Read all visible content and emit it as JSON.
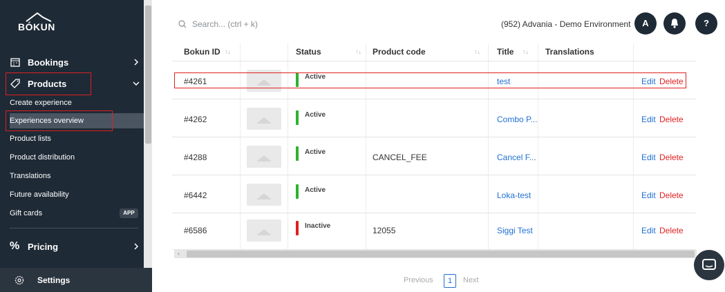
{
  "app": {
    "logo": "BÓKUN"
  },
  "sidebar": {
    "bookings": "Bookings",
    "products": "Products",
    "sub_items": [
      "Create experience",
      "Experiences overview",
      "Product lists",
      "Product distribution",
      "Translations",
      "Future availability",
      "Gift cards"
    ],
    "app_badge": "APP",
    "pricing": "Pricing",
    "settings": "Settings"
  },
  "header": {
    "search_placeholder": "Search... (ctrl + k)",
    "environment": "(952) Advania - Demo Environment",
    "avatar_letter": "A",
    "help": "?"
  },
  "table": {
    "columns": [
      "Bokun ID",
      "Status",
      "Product code",
      "Title",
      "Translations"
    ],
    "rows": [
      {
        "id": "#4261",
        "status": "Active",
        "code": "",
        "title": "test"
      },
      {
        "id": "#4262",
        "status": "Active",
        "code": "",
        "title": "Combo P..."
      },
      {
        "id": "#4288",
        "status": "Active",
        "code": "CANCEL_FEE",
        "title": "Cancel F..."
      },
      {
        "id": "#6442",
        "status": "Active",
        "code": "",
        "title": "Loka-test"
      },
      {
        "id": "#6586",
        "status": "Inactive",
        "code": "12055",
        "title": "Siggi Test"
      }
    ],
    "edit_label": "Edit",
    "delete_label": "Delete"
  },
  "pager": {
    "previous": "Previous",
    "page": "1",
    "next": "Next"
  },
  "colors": {
    "sidebar": "#1e2a36",
    "active": "#2db32d",
    "inactive": "#e02020",
    "link": "#1f6fd1",
    "highlight": "#e02020"
  }
}
